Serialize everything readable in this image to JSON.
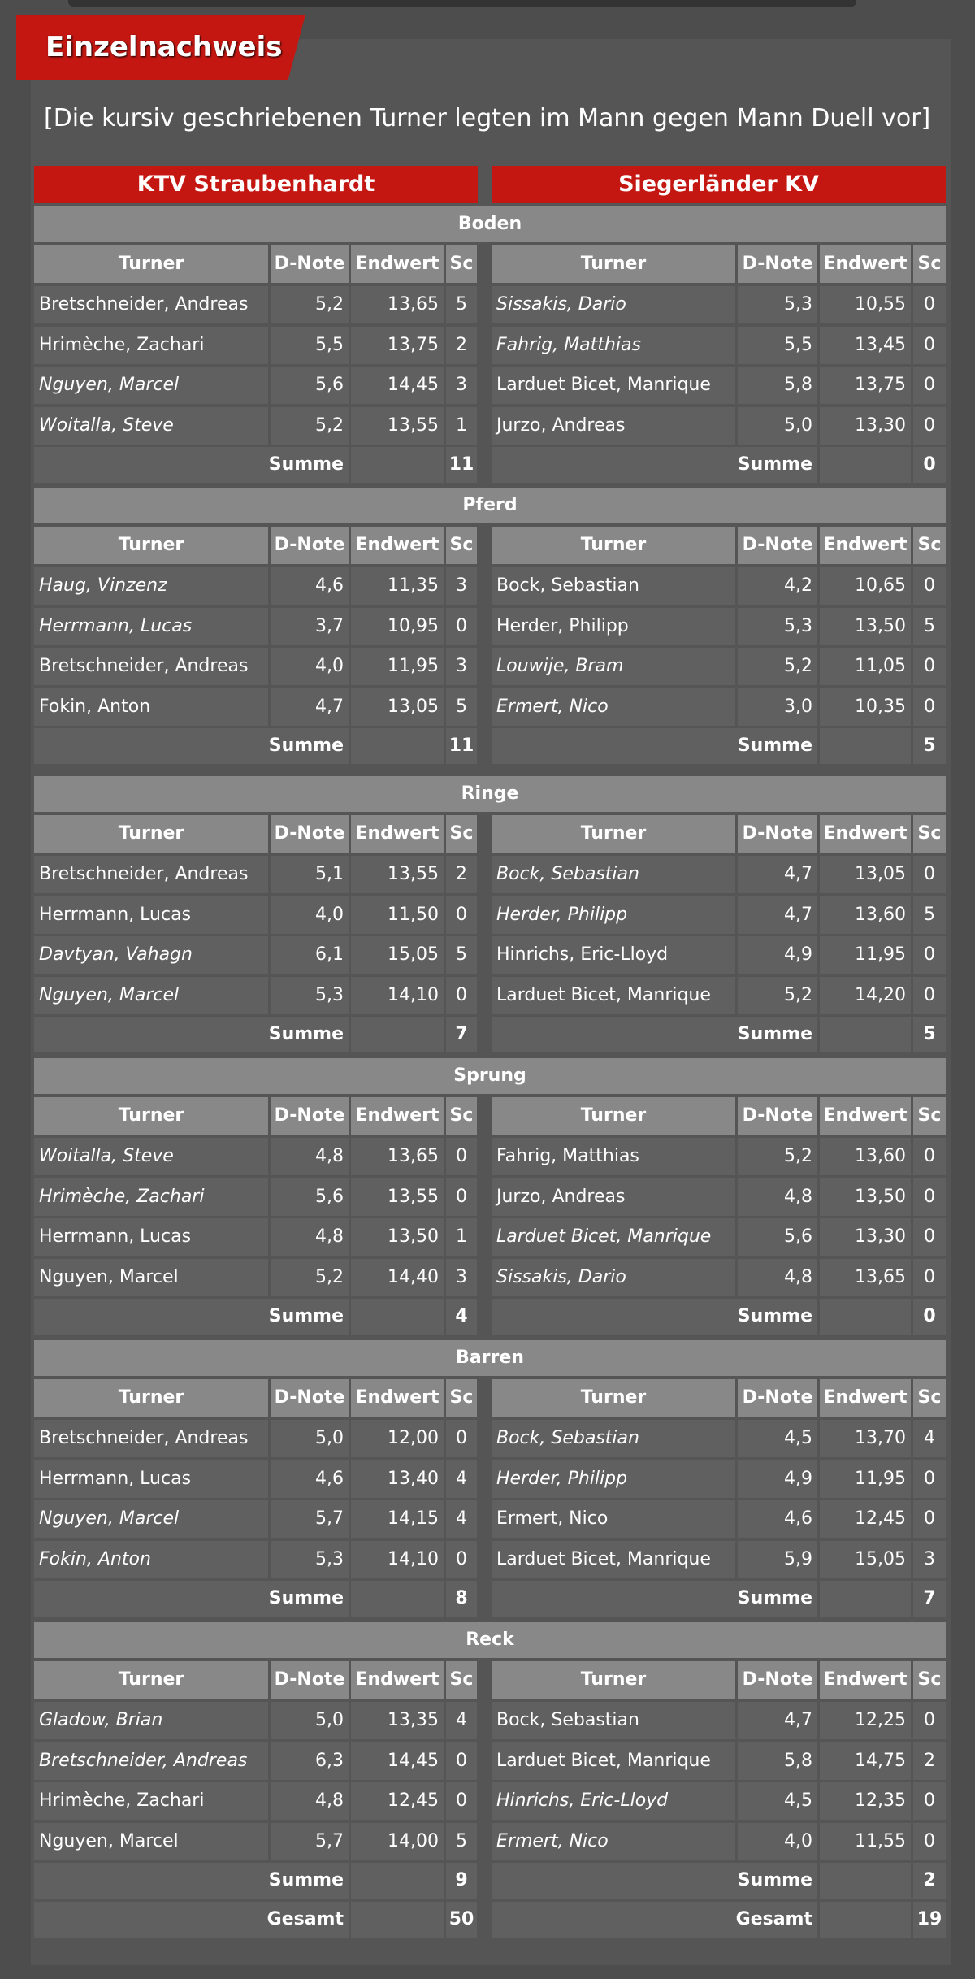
{
  "title": "Einzelnachweis",
  "intro": "[Die kursiv geschriebenen Turner legten im Mann gegen Mann Duell vor]",
  "teams": [
    "KTV Straubenhardt",
    "Siegerländer KV"
  ],
  "columns": [
    "Turner",
    "D-Note",
    "Endwert",
    "Sc"
  ],
  "sum_label": "Summe",
  "total_label": "Gesamt",
  "totals": [
    "50",
    "19"
  ],
  "colors": {
    "accent": "#c41712",
    "header_gray": "#888888",
    "cell_gray": "#606060",
    "background": "#4d4d4d"
  },
  "sections": [
    {
      "name": "Boden",
      "left": [
        {
          "name": "Bretschneider, Andreas",
          "d": "5,2",
          "e": "13,65",
          "sc": "5",
          "italic": false
        },
        {
          "name": "Hrimèche, Zachari",
          "d": "5,5",
          "e": "13,75",
          "sc": "2",
          "italic": false
        },
        {
          "name": "Nguyen, Marcel",
          "d": "5,6",
          "e": "14,45",
          "sc": "3",
          "italic": true
        },
        {
          "name": "Woitalla, Steve",
          "d": "5,2",
          "e": "13,55",
          "sc": "1",
          "italic": true
        }
      ],
      "right": [
        {
          "name": "Sissakis, Dario",
          "d": "5,3",
          "e": "10,55",
          "sc": "0",
          "italic": true
        },
        {
          "name": "Fahrig, Matthias",
          "d": "5,5",
          "e": "13,45",
          "sc": "0",
          "italic": true
        },
        {
          "name": "Larduet Bicet, Manrique",
          "d": "5,8",
          "e": "13,75",
          "sc": "0",
          "italic": false
        },
        {
          "name": "Jurzo, Andreas",
          "d": "5,0",
          "e": "13,30",
          "sc": "0",
          "italic": false
        }
      ],
      "sums": [
        "11",
        "0"
      ]
    },
    {
      "name": "Pferd",
      "left": [
        {
          "name": "Haug, Vinzenz",
          "d": "4,6",
          "e": "11,35",
          "sc": "3",
          "italic": true
        },
        {
          "name": "Herrmann, Lucas",
          "d": "3,7",
          "e": "10,95",
          "sc": "0",
          "italic": true
        },
        {
          "name": "Bretschneider, Andreas",
          "d": "4,0",
          "e": "11,95",
          "sc": "3",
          "italic": false
        },
        {
          "name": "Fokin, Anton",
          "d": "4,7",
          "e": "13,05",
          "sc": "5",
          "italic": false
        }
      ],
      "right": [
        {
          "name": "Bock, Sebastian",
          "d": "4,2",
          "e": "10,65",
          "sc": "0",
          "italic": false
        },
        {
          "name": "Herder, Philipp",
          "d": "5,3",
          "e": "13,50",
          "sc": "5",
          "italic": false
        },
        {
          "name": "Louwije, Bram",
          "d": "5,2",
          "e": "11,05",
          "sc": "0",
          "italic": true
        },
        {
          "name": "Ermert, Nico",
          "d": "3,0",
          "e": "10,35",
          "sc": "0",
          "italic": true
        }
      ],
      "sums": [
        "11",
        "5"
      ]
    },
    {
      "name": "Ringe",
      "left": [
        {
          "name": "Bretschneider, Andreas",
          "d": "5,1",
          "e": "13,55",
          "sc": "2",
          "italic": false
        },
        {
          "name": "Herrmann, Lucas",
          "d": "4,0",
          "e": "11,50",
          "sc": "0",
          "italic": false
        },
        {
          "name": "Davtyan, Vahagn",
          "d": "6,1",
          "e": "15,05",
          "sc": "5",
          "italic": true
        },
        {
          "name": "Nguyen, Marcel",
          "d": "5,3",
          "e": "14,10",
          "sc": "0",
          "italic": true
        }
      ],
      "right": [
        {
          "name": "Bock, Sebastian",
          "d": "4,7",
          "e": "13,05",
          "sc": "0",
          "italic": true
        },
        {
          "name": "Herder, Philipp",
          "d": "4,7",
          "e": "13,60",
          "sc": "5",
          "italic": true
        },
        {
          "name": "Hinrichs, Eric-Lloyd",
          "d": "4,9",
          "e": "11,95",
          "sc": "0",
          "italic": false
        },
        {
          "name": "Larduet Bicet, Manrique",
          "d": "5,2",
          "e": "14,20",
          "sc": "0",
          "italic": false
        }
      ],
      "sums": [
        "7",
        "5"
      ]
    },
    {
      "name": "Sprung",
      "left": [
        {
          "name": "Woitalla, Steve",
          "d": "4,8",
          "e": "13,65",
          "sc": "0",
          "italic": true
        },
        {
          "name": "Hrimèche, Zachari",
          "d": "5,6",
          "e": "13,55",
          "sc": "0",
          "italic": true
        },
        {
          "name": "Herrmann, Lucas",
          "d": "4,8",
          "e": "13,50",
          "sc": "1",
          "italic": false
        },
        {
          "name": "Nguyen, Marcel",
          "d": "5,2",
          "e": "14,40",
          "sc": "3",
          "italic": false
        }
      ],
      "right": [
        {
          "name": "Fahrig, Matthias",
          "d": "5,2",
          "e": "13,60",
          "sc": "0",
          "italic": false
        },
        {
          "name": "Jurzo, Andreas",
          "d": "4,8",
          "e": "13,50",
          "sc": "0",
          "italic": false
        },
        {
          "name": "Larduet Bicet, Manrique",
          "d": "5,6",
          "e": "13,30",
          "sc": "0",
          "italic": true
        },
        {
          "name": "Sissakis, Dario",
          "d": "4,8",
          "e": "13,65",
          "sc": "0",
          "italic": true
        }
      ],
      "sums": [
        "4",
        "0"
      ]
    },
    {
      "name": "Barren",
      "left": [
        {
          "name": "Bretschneider, Andreas",
          "d": "5,0",
          "e": "12,00",
          "sc": "0",
          "italic": false
        },
        {
          "name": "Herrmann, Lucas",
          "d": "4,6",
          "e": "13,40",
          "sc": "4",
          "italic": false
        },
        {
          "name": "Nguyen, Marcel",
          "d": "5,7",
          "e": "14,15",
          "sc": "4",
          "italic": true
        },
        {
          "name": "Fokin, Anton",
          "d": "5,3",
          "e": "14,10",
          "sc": "0",
          "italic": true
        }
      ],
      "right": [
        {
          "name": "Bock, Sebastian",
          "d": "4,5",
          "e": "13,70",
          "sc": "4",
          "italic": true
        },
        {
          "name": "Herder, Philipp",
          "d": "4,9",
          "e": "11,95",
          "sc": "0",
          "italic": true
        },
        {
          "name": "Ermert, Nico",
          "d": "4,6",
          "e": "12,45",
          "sc": "0",
          "italic": false
        },
        {
          "name": "Larduet Bicet, Manrique",
          "d": "5,9",
          "e": "15,05",
          "sc": "3",
          "italic": false
        }
      ],
      "sums": [
        "8",
        "7"
      ]
    },
    {
      "name": "Reck",
      "left": [
        {
          "name": "Gladow, Brian",
          "d": "5,0",
          "e": "13,35",
          "sc": "4",
          "italic": true
        },
        {
          "name": "Bretschneider, Andreas",
          "d": "6,3",
          "e": "14,45",
          "sc": "0",
          "italic": true
        },
        {
          "name": "Hrimèche, Zachari",
          "d": "4,8",
          "e": "12,45",
          "sc": "0",
          "italic": false
        },
        {
          "name": "Nguyen, Marcel",
          "d": "5,7",
          "e": "14,00",
          "sc": "5",
          "italic": false
        }
      ],
      "right": [
        {
          "name": "Bock, Sebastian",
          "d": "4,7",
          "e": "12,25",
          "sc": "0",
          "italic": false
        },
        {
          "name": "Larduet Bicet, Manrique",
          "d": "5,8",
          "e": "14,75",
          "sc": "2",
          "italic": false
        },
        {
          "name": "Hinrichs, Eric-Lloyd",
          "d": "4,5",
          "e": "12,35",
          "sc": "0",
          "italic": true
        },
        {
          "name": "Ermert, Nico",
          "d": "4,0",
          "e": "11,55",
          "sc": "0",
          "italic": true
        }
      ],
      "sums": [
        "9",
        "2"
      ]
    }
  ]
}
